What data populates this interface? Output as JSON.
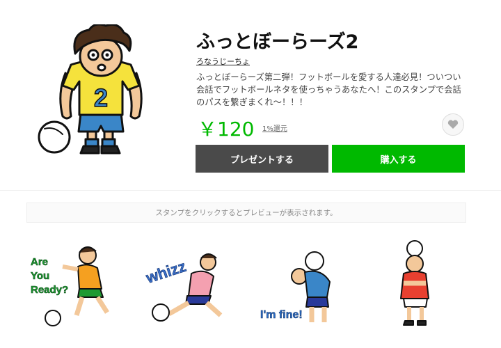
{
  "product": {
    "title": "ふっとぼーらーズ2",
    "author": "ろなうじーちょ",
    "description": "ふっとぼーらーズ第二弾！フットボールを愛する人達必見！ついつい会話でフットボールネタを使っちゃうあなたへ！このスタンプで会話のパスを繋ぎまくれ〜！！！",
    "jersey_number": "2",
    "price": "￥120",
    "cashback": "1%還元",
    "favorite_icon": "heart-icon"
  },
  "buttons": {
    "gift_label": "プレゼントする",
    "buy_label": "購入する"
  },
  "preview_notice": "スタンプをクリックするとプレビューが表示されます。",
  "stickers": [
    {
      "caption_lines": [
        "Are",
        "You",
        "Ready?"
      ]
    },
    {
      "caption": "whizz"
    },
    {
      "caption": "I'm fine!"
    },
    {
      "caption": ""
    }
  ],
  "colors": {
    "brand_green": "#00b900",
    "gift_button": "#4a4a4a",
    "jersey_yellow": "#f5e23c",
    "jersey_number_blue": "#3a86c8"
  }
}
